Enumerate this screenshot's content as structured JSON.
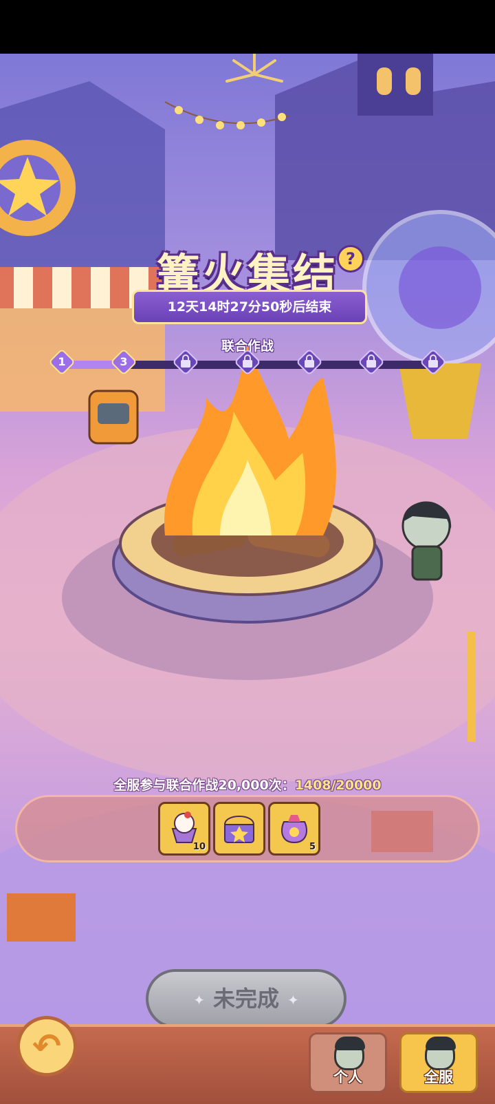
{
  "event": {
    "title": "篝火集结",
    "timer": "12天14时27分50秒后结束",
    "subtitle": "联合作战",
    "progress": {
      "nodes": [
        {
          "label": "1",
          "unlocked": true
        },
        {
          "label": "3",
          "unlocked": true
        },
        {
          "label": "",
          "unlocked": false
        },
        {
          "label": "",
          "unlocked": false
        },
        {
          "label": "",
          "unlocked": false
        },
        {
          "label": "",
          "unlocked": false
        },
        {
          "label": "",
          "unlocked": false
        }
      ],
      "unlocked_fraction": 0.167
    }
  },
  "participation": {
    "label": "全服参与联合作战20,000次：",
    "current": "1408/20000"
  },
  "rewards": [
    {
      "icon": "cupcake-icon",
      "count": "10"
    },
    {
      "icon": "treasure-chest-icon",
      "count": ""
    },
    {
      "icon": "gift-bag-icon",
      "count": "5"
    }
  ],
  "status_button": {
    "label": "未完成"
  },
  "tabs": {
    "personal": "个人",
    "server": "全服"
  },
  "colors": {
    "accent": "#f7c44c",
    "panel": "#6a41b6",
    "bottom_bar": "#c56a4e"
  }
}
